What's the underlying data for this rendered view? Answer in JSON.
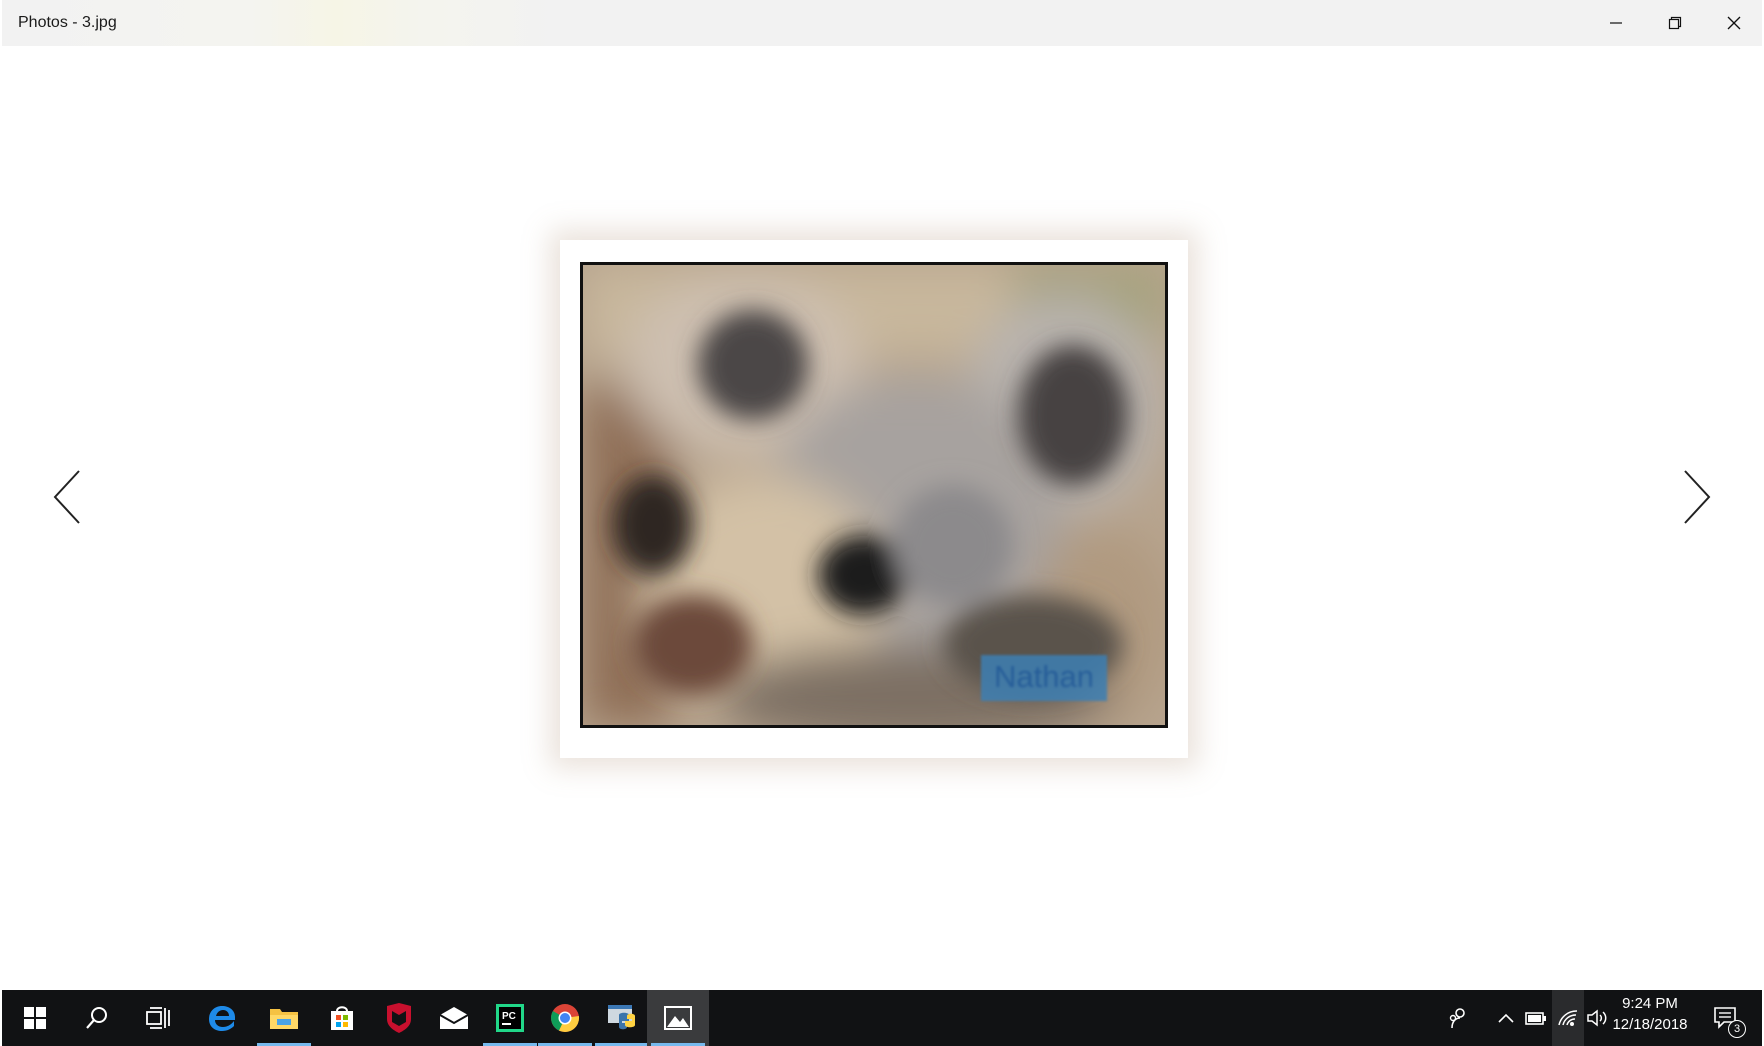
{
  "window": {
    "title": "Photos - 3.jpg",
    "controls": [
      "minimize",
      "restore",
      "close"
    ]
  },
  "photo": {
    "caption": "Nathan",
    "caption_color": "#1d5fa6"
  },
  "navigation": {
    "prev_icon": "chevron-left-icon",
    "next_icon": "chevron-right-icon"
  },
  "taskbar": {
    "background": "#111214",
    "accent": "#76b9ed",
    "pinned": [
      {
        "name": "start-button",
        "icon": "windows-logo-icon"
      },
      {
        "name": "search-button",
        "icon": "search-icon"
      },
      {
        "name": "task-view-button",
        "icon": "task-view-icon"
      },
      {
        "name": "edge-button",
        "icon": "edge-icon"
      },
      {
        "name": "file-explorer-button",
        "icon": "folder-icon",
        "running": true
      },
      {
        "name": "store-button",
        "icon": "store-icon"
      },
      {
        "name": "mcafee-button",
        "icon": "mcafee-icon"
      },
      {
        "name": "mail-button",
        "icon": "mail-icon"
      },
      {
        "name": "pycharm-button",
        "icon": "pycharm-icon",
        "running": true
      },
      {
        "name": "chrome-button",
        "icon": "chrome-icon",
        "running": true
      },
      {
        "name": "python-button",
        "icon": "python-icon",
        "running": true
      },
      {
        "name": "photos-button",
        "icon": "photos-icon",
        "running": true,
        "active": true
      }
    ],
    "tray": {
      "time": "9:24 PM",
      "date": "12/18/2018",
      "notification_count": "3"
    }
  }
}
